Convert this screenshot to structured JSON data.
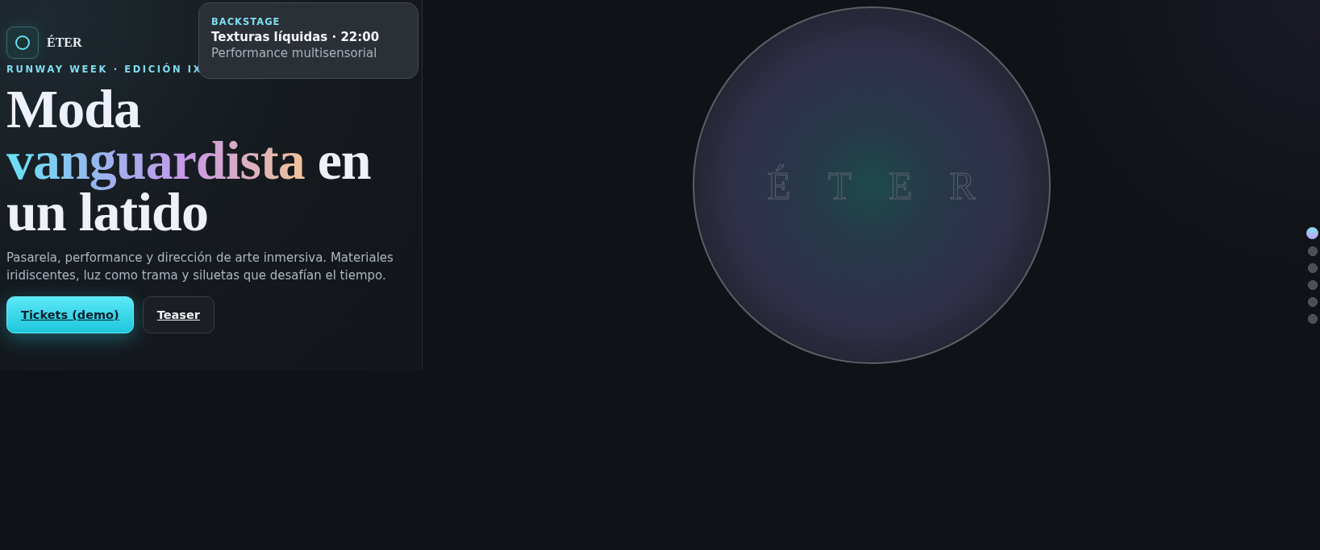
{
  "brand": {
    "name": "ÉTER"
  },
  "card": {
    "eyebrow": "BACKSTAGE",
    "title": "Texturas líquidas · 22:00",
    "subtitle": "Performance multisensorial"
  },
  "eyebrow": "RUNWAY WEEK · EDICIÓN IX",
  "headline": {
    "before": "Moda",
    "highlight": "vanguardista",
    "after": "en un latido"
  },
  "description": "Pasarela, performance y dirección de arte inmersiva. Materiales iridiscentes, luz como trama y siluetas que desafían el tiempo.",
  "buttons": [
    {
      "label": "Tickets (demo)",
      "kind": "primary"
    },
    {
      "label": "Teaser",
      "kind": "secondary"
    }
  ],
  "orb": {
    "letters": [
      "É",
      "T",
      "E",
      "R"
    ]
  },
  "nav_dots": [
    {
      "selected": true
    },
    {
      "selected": false
    },
    {
      "selected": false
    },
    {
      "selected": false
    },
    {
      "selected": false
    },
    {
      "selected": false
    }
  ]
}
